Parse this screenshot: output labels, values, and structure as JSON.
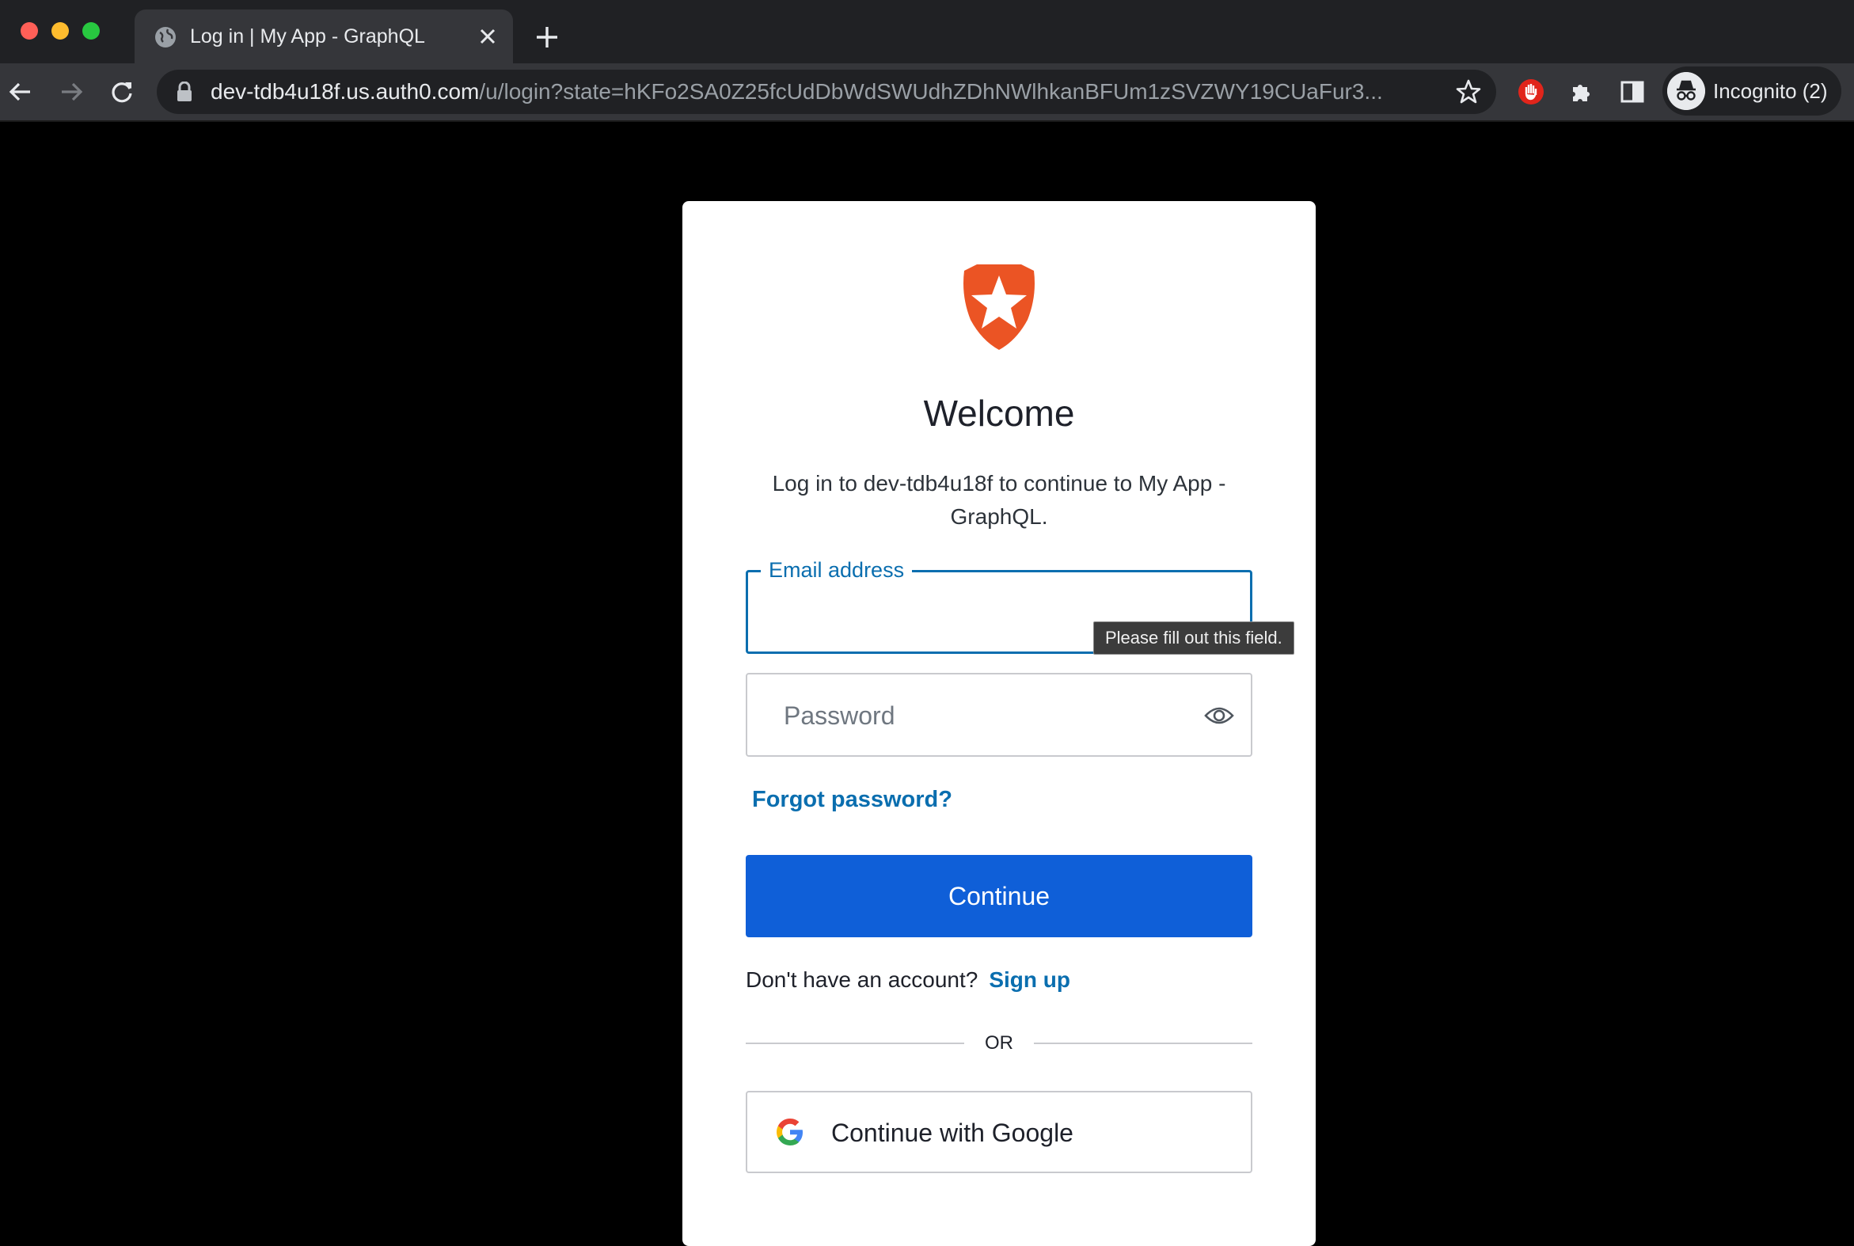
{
  "browser": {
    "tab_title": "Log in | My App - GraphQL",
    "url_host": "dev-tdb4u18f.us.auth0.com",
    "url_path": "/u/login?state=hKFo2SA0Z25fcUdDbWdSWUdhZDhNWlhkanBFUm1zSVZWY19CUaFur3...",
    "profile_label": "Incognito (2)"
  },
  "login": {
    "heading": "Welcome",
    "subtitle": "Log in to dev-tdb4u18f to continue to My App - GraphQL.",
    "email_label": "Email address",
    "email_value": "",
    "validation_tooltip": "Please fill out this field.",
    "password_placeholder": "Password",
    "forgot_password": "Forgot password?",
    "continue_label": "Continue",
    "signup_prompt": "Don't have an account?",
    "signup_link": "Sign up",
    "divider_text": "OR",
    "google_label": "Continue with Google"
  },
  "colors": {
    "accent": "#0a6eaf",
    "primary_button": "#0f5fd8",
    "logo": "#eb5424"
  },
  "icons": [
    "globe-icon",
    "close-icon",
    "plus-icon",
    "back-icon",
    "forward-icon",
    "reload-icon",
    "lock-icon",
    "star-icon",
    "adblock-icon",
    "extensions-icon",
    "sidepanel-icon",
    "incognito-icon",
    "auth0-logo",
    "eye-icon",
    "google-icon"
  ]
}
